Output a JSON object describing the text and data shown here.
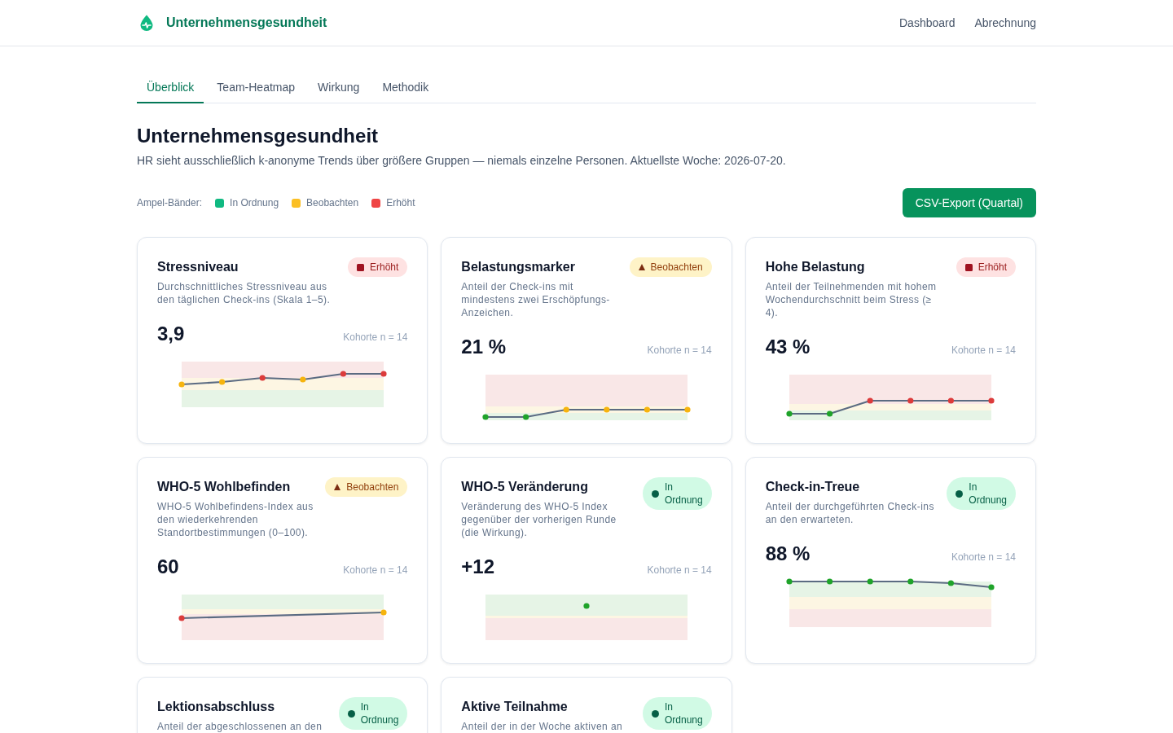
{
  "header": {
    "brand": "Unternehmensgesundheit",
    "nav": [
      {
        "label": "Dashboard"
      },
      {
        "label": "Abrechnung"
      }
    ]
  },
  "tabs": [
    {
      "label": "Überblick",
      "selected": true
    },
    {
      "label": "Team-Heatmap",
      "selected": false
    },
    {
      "label": "Wirkung",
      "selected": false
    },
    {
      "label": "Methodik",
      "selected": false
    }
  ],
  "page": {
    "title": "Unternehmensgesundheit",
    "subtitle": "HR sieht ausschließlich k-anonyme Trends über größere Gruppen — niemals einzelne Personen. Aktuellste Woche: 2026-07-20."
  },
  "legend": {
    "label": "Ampel-Bänder:",
    "items": [
      {
        "label": "In Ordnung",
        "color": "#10b981"
      },
      {
        "label": "Beobachten",
        "color": "#fbbf24"
      },
      {
        "label": "Erhöht",
        "color": "#ef4444"
      }
    ]
  },
  "export_button": {
    "label": "CSV-Export (Quartal)"
  },
  "cards": [
    {
      "title": "Stressniveau",
      "description": "Durchschnittliches Stressniveau aus den täglichen Check-ins (Skala 1–5).",
      "status": {
        "kind": "elevated",
        "label": "Erhöht"
      },
      "value": "3,9",
      "cohort": "Kohorte n = 14"
    },
    {
      "title": "Belastungsmarker",
      "description": "Anteil der Check-ins mit mindestens zwei Erschöpfungs-Anzeichen.",
      "status": {
        "kind": "watch",
        "label": "Beobachten"
      },
      "value": "21 %",
      "cohort": "Kohorte n = 14"
    },
    {
      "title": "Hohe Belastung",
      "description": "Anteil der Teilnehmenden mit hohem Wochendurchschnitt beim Stress (≥ 4).",
      "status": {
        "kind": "elevated",
        "label": "Erhöht"
      },
      "value": "43 %",
      "cohort": "Kohorte n = 14"
    },
    {
      "title": "WHO-5 Wohlbefinden",
      "description": "WHO-5 Wohlbefindens-Index aus den wiederkehrenden Standortbestimmungen (0–100).",
      "status": {
        "kind": "watch",
        "label": "Beobachten"
      },
      "value": "60",
      "cohort": "Kohorte n = 14"
    },
    {
      "title": "WHO-5 Veränderung",
      "description": "Veränderung des WHO-5 Index gegenüber der vorherigen Runde (die Wirkung).",
      "status": {
        "kind": "ok",
        "label": "In Ordnung"
      },
      "value": "+12",
      "cohort": "Kohorte n = 14"
    },
    {
      "title": "Check-in-Treue",
      "description": "Anteil der durchgeführten Check-ins an den erwarteten.",
      "status": {
        "kind": "ok",
        "label": "In Ordnung"
      },
      "value": "88 %",
      "cohort": "Kohorte n = 14"
    },
    {
      "title": "Lektionsabschluss",
      "description": "Anteil der abgeschlossenen an den",
      "status": {
        "kind": "ok",
        "label": "In Ordnung"
      }
    },
    {
      "title": "Aktive Teilnahme",
      "description": "Anteil der in der Woche aktiven an",
      "status": {
        "kind": "ok",
        "label": "In Ordnung"
      }
    }
  ]
}
